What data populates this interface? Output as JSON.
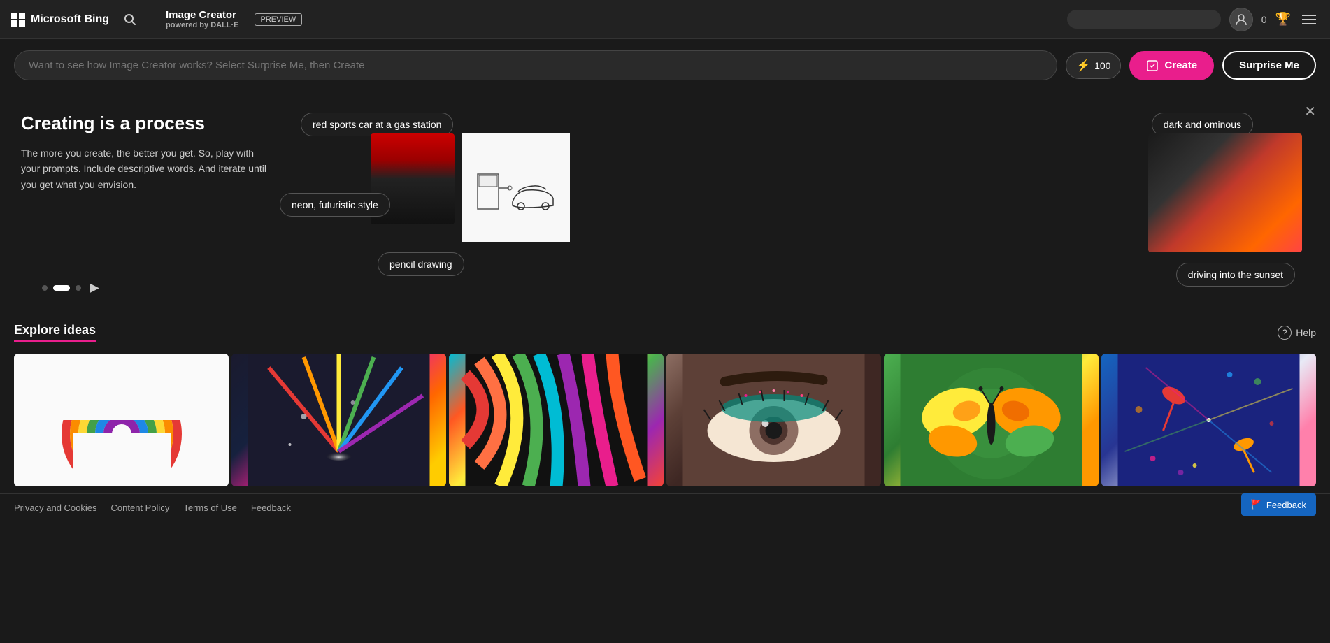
{
  "header": {
    "windows_logo": "⊞",
    "brand": "Microsoft Bing",
    "image_creator_title": "Image Creator",
    "image_creator_powered": "powered by",
    "image_creator_dalle": "DALL·E",
    "preview_label": "PREVIEW",
    "search_placeholder": "",
    "coins": "0",
    "menu_icon": "☰"
  },
  "search_bar": {
    "placeholder": "Want to see how Image Creator works? Select Surprise Me, then Create",
    "coins_count": "100",
    "create_label": "Create",
    "surprise_label": "Surprise Me"
  },
  "tutorial": {
    "close_icon": "✕",
    "title": "Creating is a process",
    "description": "The more you create, the better you get. So, play with your prompts. Include descriptive words. And iterate until you get what you envision.",
    "prompt_main": "red sports car at a gas station",
    "prompt_neon": "neon, futuristic style",
    "prompt_pencil": "pencil drawing",
    "prompt_dark": "dark and ominous",
    "prompt_sunset": "driving into the sunset"
  },
  "carousel": {
    "dots": [
      "inactive",
      "active",
      "inactive"
    ],
    "next_icon": "▶"
  },
  "explore": {
    "title": "Explore ideas",
    "help_icon": "?",
    "help_label": "Help"
  },
  "footer": {
    "privacy": "Privacy and Cookies",
    "content_policy": "Content Policy",
    "terms": "Terms of Use",
    "feedback": "Feedback",
    "feedback_icon": "🚩"
  }
}
